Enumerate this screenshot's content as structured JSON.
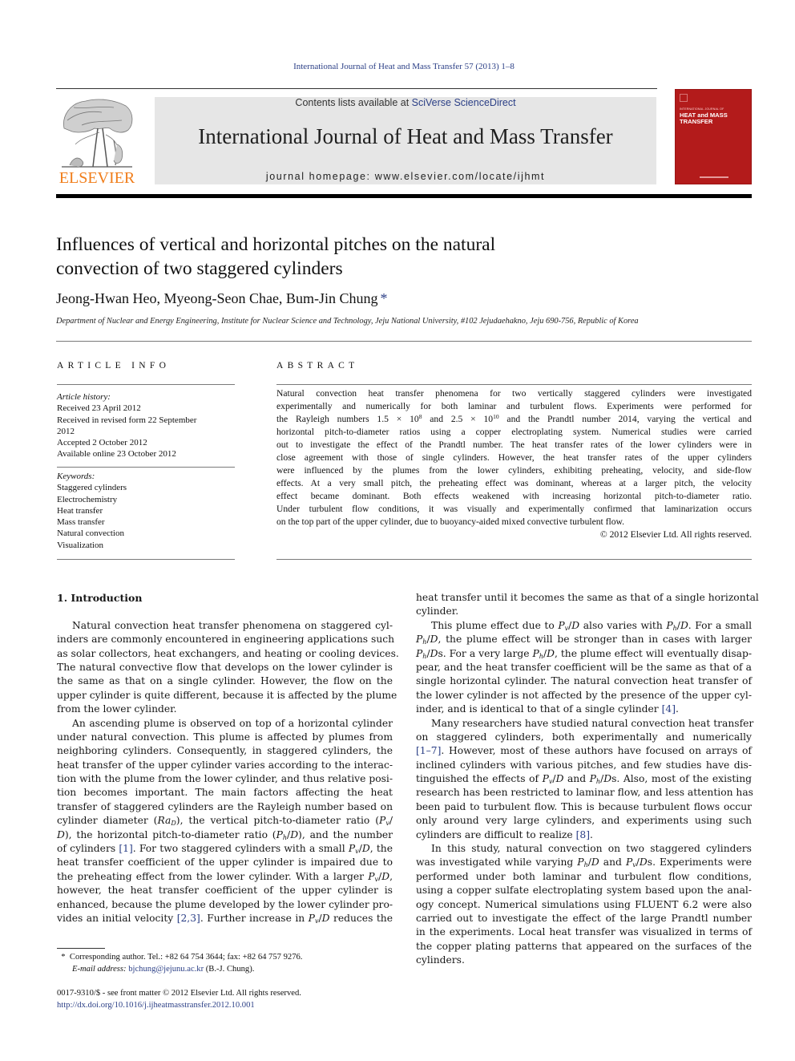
{
  "running_head": "International Journal of Heat and Mass Transfer 57 (2013) 1–8",
  "publisher": {
    "name": "ELSEVIER",
    "brand_color": "#f07d1a"
  },
  "banner": {
    "contents_prefix": "Contents lists available at ",
    "contents_link": "SciVerse ScienceDirect",
    "journal_title": "International Journal of Heat and Mass Transfer",
    "homepage": "journal homepage: www.elsevier.com/locate/ijhmt"
  },
  "cover": {
    "series": "INTERNATIONAL JOURNAL OF",
    "title_line1": "HEAT and MASS",
    "title_line2": "TRANSFER",
    "color": "#b31b1b"
  },
  "article": {
    "title_line1": "Influences of vertical and horizontal pitches on the natural",
    "title_line2": "convection of two staggered cylinders",
    "authors": "Jeong-Hwan Heo, Myeong-Seon Chae, Bum-Jin Chung",
    "corresponding_mark": "*",
    "affiliation": "Department of Nuclear and Energy Engineering, Institute for Nuclear Science and Technology, Jeju National University, #102 Jejudaehakno, Jeju 690-756, Republic of Korea"
  },
  "article_info": {
    "heading": "ARTICLE INFO",
    "history_label": "Article history:",
    "history": [
      "Received 23 April 2012",
      "Received in revised form 22 September",
      "2012",
      "Accepted 2 October 2012",
      "Available online 23 October 2012"
    ],
    "keywords_label": "Keywords:",
    "keywords": [
      "Staggered cylinders",
      "Electrochemistry",
      "Heat transfer",
      "Mass transfer",
      "Natural convection",
      "Visualization"
    ]
  },
  "abstract": {
    "heading": "ABSTRACT",
    "lines": [
      "Natural convection heat transfer phenomena for two vertically staggered cylinders were investigated",
      "experimentally and numerically for both laminar and turbulent flows. Experiments were performed for",
      null,
      "horizontal pitch-to-diameter ratios using a copper electroplating system. Numerical studies were carried",
      "out to investigate the effect of the Prandtl number. The heat transfer rates of the lower cylinders were in",
      "close agreement with those of single cylinders. However, the heat transfer rates of the upper cylinders",
      "were influenced by the plumes from the lower cylinders, exhibiting preheating, velocity, and side-flow",
      "effects. At a very small pitch, the preheating effect was dominant, whereas at a larger pitch, the velocity",
      "effect became dominant. Both effects weakened with increasing horizontal pitch-to-diameter ratio.",
      "Under turbulent flow conditions, it was visually and experimentally confirmed that laminarization occurs",
      "on the top part of the upper cylinder, due to buoyancy-aided mixed convective turbulent flow."
    ],
    "line3": {
      "a": "the Rayleigh numbers 1.5 × 10",
      "exp1": "8",
      "b": " and 2.5 × 10",
      "exp2": "10",
      "c": " and the Prandtl number 2014, varying the vertical and"
    },
    "copyright": "© 2012 Elsevier Ltd. All rights reserved."
  },
  "intro": {
    "heading": "1. Introduction",
    "left_plain": [
      "Natural convection heat transfer phenomena on staggered cyl-",
      "inders are commonly encountered in engineering applications such",
      "as solar collectors, heat exchangers, and heating or cooling devices.",
      "The natural convective flow that develops on the lower cylinder is",
      "the same as that on a single cylinder. However, the flow on the",
      "upper cylinder is quite different, because it is affected by the plume",
      "from the lower cylinder.",
      "An ascending plume is observed on top of a horizontal cylinder",
      "under natural convection. This plume is affected by plumes from",
      "neighboring cylinders. Consequently, in staggered cylinders, the",
      "heat transfer of the upper cylinder varies according to the interac-",
      "tion with the plume from the lower cylinder, and thus relative posi-",
      "tion becomes important. The main factors affecting the heat",
      "transfer of staggered cylinders are the Rayleigh number based on"
    ],
    "left_rich": {
      "l15a": "cylinder diameter (",
      "l15b": "), the vertical pitch-to-diameter ratio (",
      "l16b": "), the horizontal pitch-to-diameter ratio (",
      "l16c": "), and the number",
      "l17a": "of cylinders ",
      "ref1": "[1]",
      "l17b": ". For two staggered cylinders with a small ",
      "l17c": ", the",
      "l18": "heat transfer coefficient of the upper cylinder is impaired due to",
      "l19a": "the preheating effect from the lower cylinder. With a larger ",
      "l19b": ",",
      "l20": "however, the heat transfer coefficient of the upper cylinder is",
      "l21": "enhanced, because the plume developed by the lower cylinder pro-",
      "l22a": "vides an initial velocity ",
      "ref23": "[2,3]",
      "l22b": ". Further increase in ",
      "l22c": " reduces the"
    },
    "right": {
      "r1": "heat transfer until it becomes the same as that of a single horizontal",
      "r2": "cylinder.",
      "r3a": "This plume effect due to ",
      "r3b": " also varies with ",
      "r3c": ". For a small",
      "r4b": ", the plume effect will be stronger than in cases with larger",
      "r5b": "s. For a very large ",
      "r5c": ", the plume effect will eventually disap-",
      "r6": "pear, and the heat transfer coefficient will be the same as that of a",
      "r7": "single horizontal cylinder. The natural convection heat transfer of",
      "r8": "the lower cylinder is not affected by the presence of the upper cyl-",
      "r9a": "inder, and is identical to that of a single cylinder ",
      "ref4": "[4]",
      "r9b": ".",
      "r10": "Many researchers have studied natural convection heat transfer",
      "r11": "on staggered cylinders, both experimentally and numerically",
      "ref17": "[1–7]",
      "r12b": ". However, most of these authors have focused on arrays of",
      "r13": "inclined cylinders with various pitches, and few studies have dis-",
      "r14a": "tinguished the effects of ",
      "r14b": " and ",
      "r14c": "s. Also, most of the existing",
      "r15": "research has been restricted to laminar flow, and less attention has",
      "r16": "been paid to turbulent flow. This is because turbulent flows occur",
      "r17": "only around very large cylinders, and experiments using such",
      "r18a": "cylinders are difficult to realize ",
      "ref8": "[8]",
      "r18b": ".",
      "r19": "In this study, natural convection on two staggered cylinders",
      "r20a": "was investigated while varying ",
      "r20b": " and ",
      "r20c": "s. Experiments were",
      "r21": "performed under both laminar and turbulent flow conditions,",
      "r22": "using a copper sulfate electroplating system based upon the anal-",
      "r23": "ogy concept. Numerical simulations using FLUENT 6.2 were also",
      "r24": "carried out to investigate the effect of the large Prandtl number",
      "r25": "in the experiments. Local heat transfer was visualized in terms of",
      "r26": "the copper plating patterns that appeared on the surfaces of the",
      "r27": "cylinders."
    },
    "symbols": {
      "Ra": "Ra",
      "Ra_sub": "D",
      "P": "P",
      "v": "v",
      "h": "h",
      "D": "D",
      "slash": "/"
    }
  },
  "footnote": {
    "mark": "*",
    "corresponding": "Corresponding author. Tel.: +82 64 754 3644; fax: +82 64 757 9276.",
    "email_label": "E-mail address:",
    "email": "bjchung@jejunu.ac.kr",
    "email_owner": " (B.-J. Chung)."
  },
  "front_matter": {
    "issn_line": "0017-9310/$ - see front matter © 2012 Elsevier Ltd. All rights reserved.",
    "doi": "http://dx.doi.org/10.1016/j.ijheatmasstransfer.2012.10.001"
  },
  "colors": {
    "link": "#2b3f86",
    "banner_bg": "#e6e6e6"
  }
}
